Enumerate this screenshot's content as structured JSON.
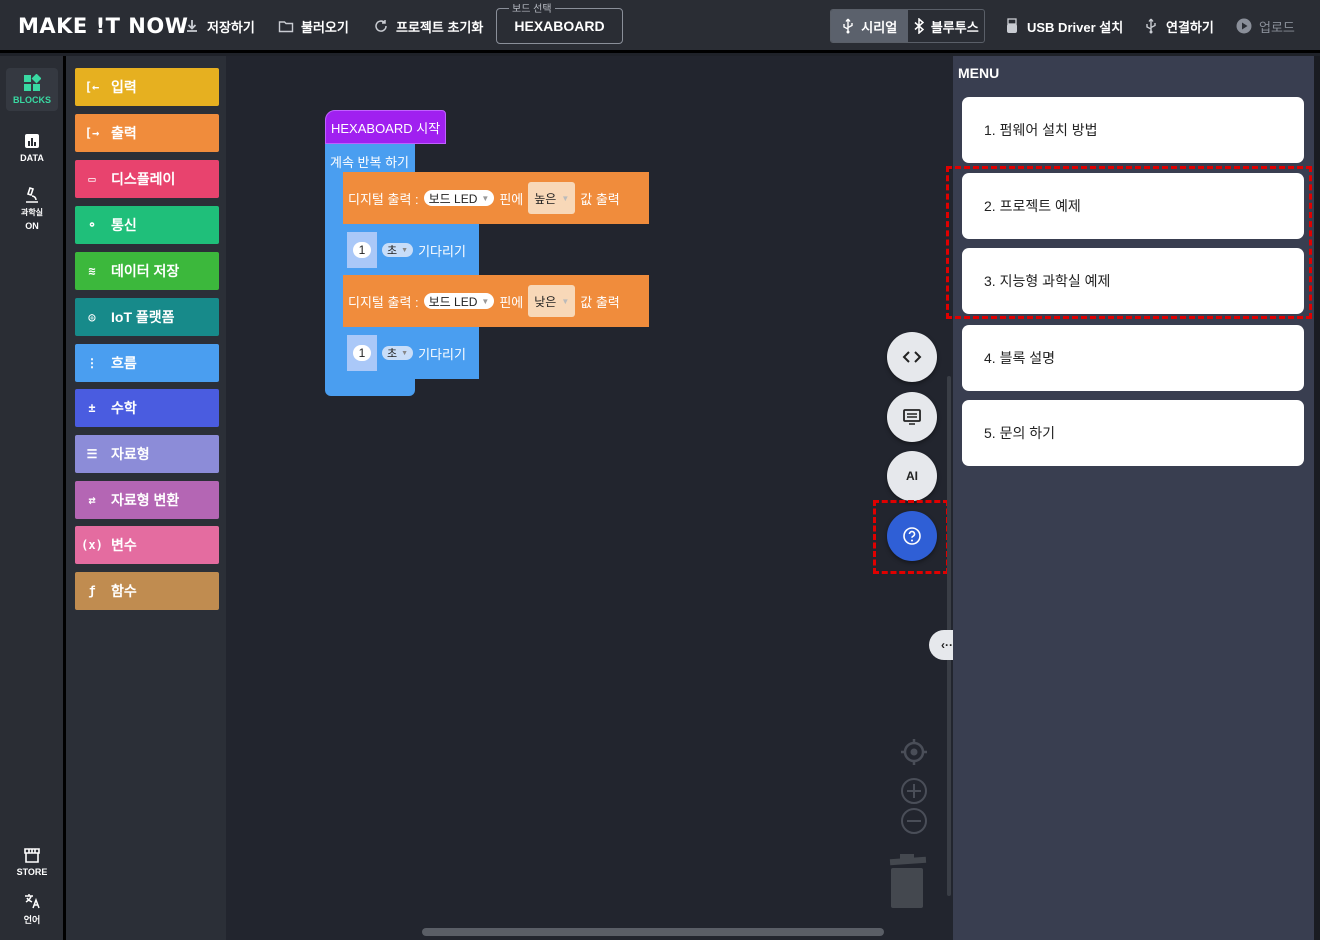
{
  "app": {
    "logo": "MAKE !T NOW"
  },
  "toolbar": {
    "save": "저장하기",
    "load": "불러오기",
    "reset": "프로젝트 초기화",
    "board_legend": "보드 선택",
    "board_value": "HEXABOARD",
    "serial": "시리얼",
    "bluetooth": "블루투스",
    "usb_driver": "USB Driver 설치",
    "connect": "연결하기",
    "upload": "업로드"
  },
  "rail": {
    "blocks": "BLOCKS",
    "data": "DATA",
    "lab_line1": "과학실",
    "lab_line2": "ON",
    "store": "STORE",
    "language": "언어"
  },
  "categories": [
    {
      "label": "입력",
      "color": "#e6b020"
    },
    {
      "label": "출력",
      "color": "#f08c3c"
    },
    {
      "label": "디스플레이",
      "color": "#e8436e"
    },
    {
      "label": "통신",
      "color": "#1fbf7a"
    },
    {
      "label": "데이터 저장",
      "color": "#3cb83c"
    },
    {
      "label": "IoT 플랫폼",
      "color": "#178a8a"
    },
    {
      "label": "흐름",
      "color": "#4a9ef0"
    },
    {
      "label": "수학",
      "color": "#4a5ce0"
    },
    {
      "label": "자료형",
      "color": "#8c8cd8"
    },
    {
      "label": "자료형 변환",
      "color": "#b466b4"
    },
    {
      "label": "변수",
      "color": "#e46ca0"
    },
    {
      "label": "함수",
      "color": "#c08c50"
    }
  ],
  "workspace": {
    "hat": "HEXABOARD 시작",
    "loop": "계속 반복 하기",
    "out1": {
      "prefix": "디지털 출력 :",
      "pin": "보드 LED",
      "mid": "핀에",
      "value": "높은",
      "suffix": "값 출력"
    },
    "wait1": {
      "num": "1",
      "unit": "초",
      "label": "기다리기"
    },
    "out2": {
      "prefix": "디지털 출력 :",
      "pin": "보드 LED",
      "mid": "핀에",
      "value": "낮은",
      "suffix": "값 출력"
    },
    "wait2": {
      "num": "1",
      "unit": "초",
      "label": "기다리기"
    }
  },
  "fabs": {
    "ai": "AI"
  },
  "menu": {
    "title": "MENU",
    "items": [
      "1. 펌웨어 설치 방법",
      "2. 프로젝트 예제",
      "3. 지능형 과학실 예제",
      "4. 블록 설명",
      "5. 문의 하기"
    ]
  },
  "colors": {
    "accent": "#39d9a2",
    "help_button": "#2f5fd6",
    "highlight": "#e00000"
  }
}
